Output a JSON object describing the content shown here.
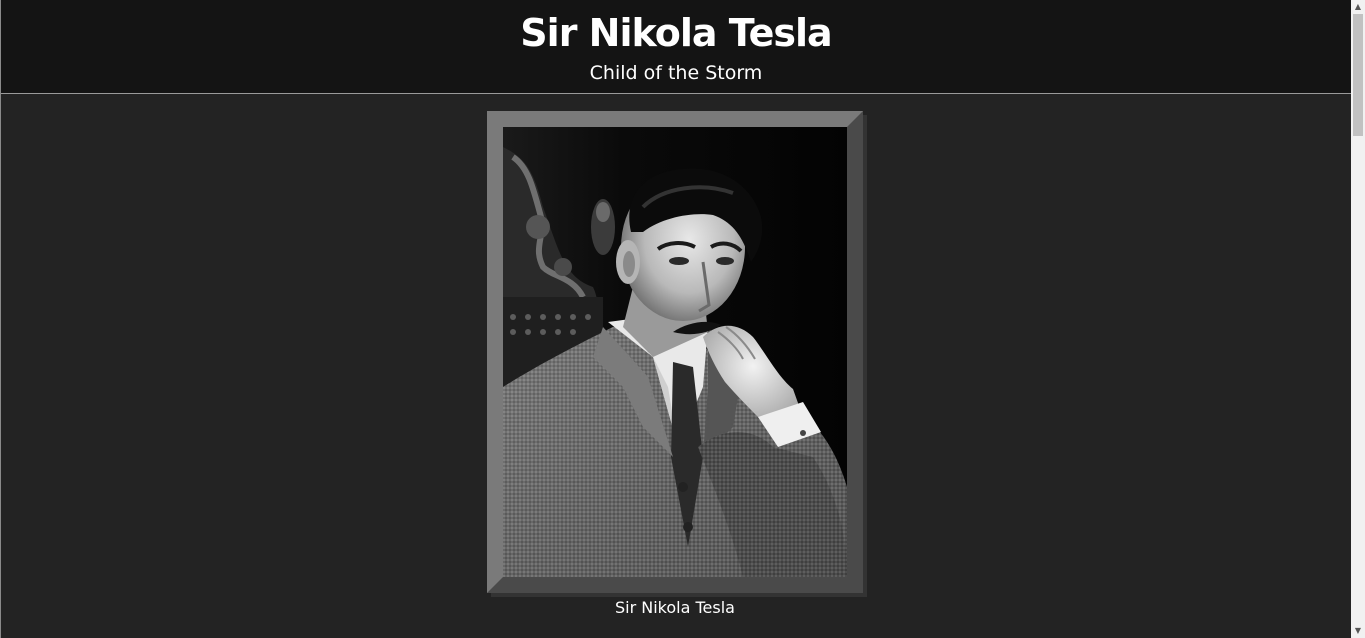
{
  "header": {
    "title": "Sir Nikola Tesla",
    "subtitle": "Child of the Storm"
  },
  "portrait": {
    "alt": "Sir Nikola Tesla",
    "caption": "Sir Nikola Tesla"
  },
  "scrollbar": {
    "up_icon": "triangle-up",
    "down_icon": "triangle-down"
  }
}
